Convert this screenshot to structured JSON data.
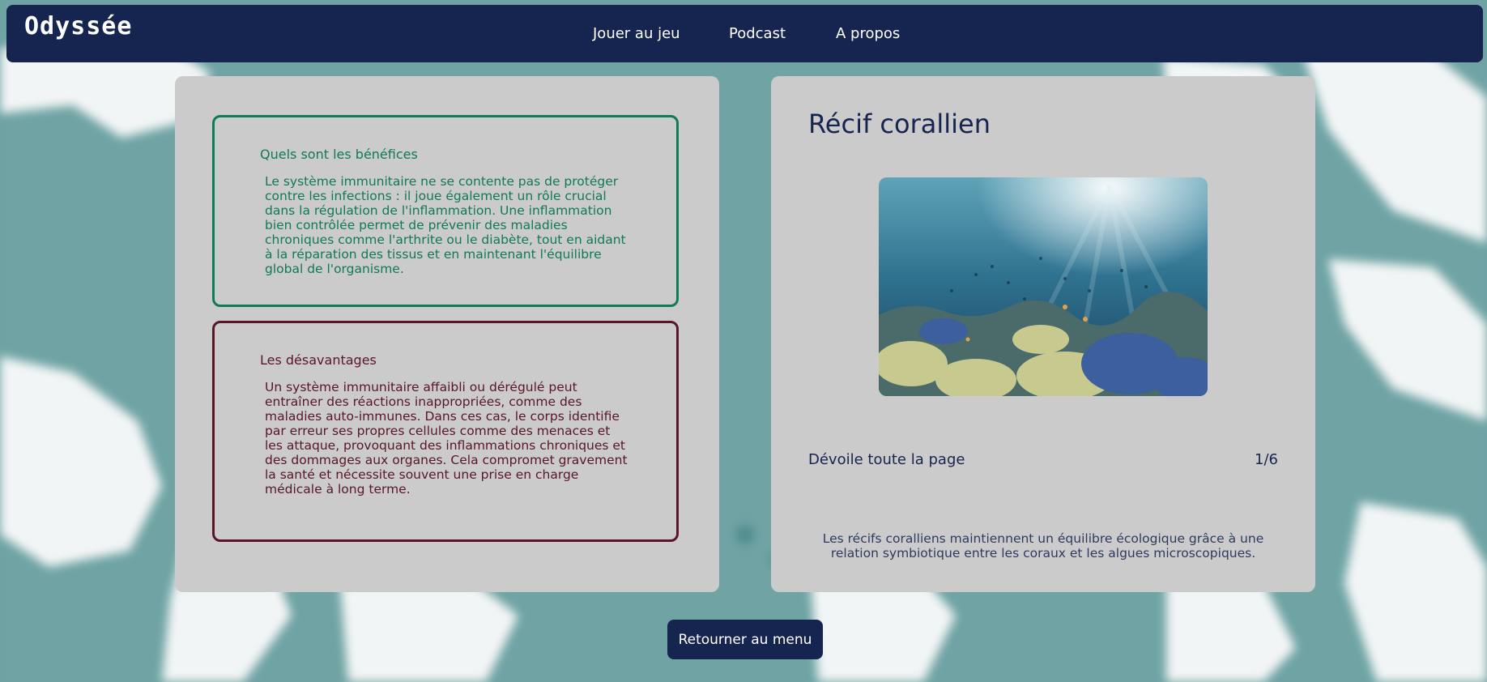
{
  "brand": {
    "logo_text": "Odyssée"
  },
  "nav": {
    "items": [
      {
        "label": "Jouer au jeu"
      },
      {
        "label": "Podcast"
      },
      {
        "label": "A propos"
      }
    ]
  },
  "left_panel": {
    "benefits": {
      "title": "Quels sont les bénéfices",
      "text": "Le système immunitaire ne se contente pas de protéger contre les infections : il joue également un rôle crucial dans la régulation de l'inflammation. Une inflammation bien contrôlée permet de prévenir des maladies chroniques comme l'arthrite ou le diabète, tout en aidant à la réparation des tissus et en maintenant l'équilibre global de l'organisme."
    },
    "drawbacks": {
      "title": "Les désavantages",
      "text": "Un système immunitaire affaibli ou dérégulé peut entraîner des réactions inappropriées, comme des maladies auto-immunes. Dans ces cas, le corps identifie par erreur ses propres cellules comme des menaces et les attaque, provoquant des inflammations chroniques et des dommages aux organes. Cela compromet gravement la santé et nécessite souvent une prise en charge médicale à long terme."
    }
  },
  "right_panel": {
    "title": "Récif corallien",
    "image_icon": "coral-reef-photo",
    "reveal_label": "Dévoile toute la page",
    "page_counter": "1/6",
    "caption": "Les récifs coralliens maintiennent un équilibre écologique grâce à une relation symbiotique entre les coraux et les algues microscopiques."
  },
  "footer": {
    "back_label": "Retourner au menu"
  },
  "colors": {
    "navy": "#16254f",
    "benefits_green": "#0f7a55",
    "drawbacks_maroon": "#5a1526",
    "panel_grey": "#cbcbcb",
    "ocean": "#6fa3a4"
  }
}
